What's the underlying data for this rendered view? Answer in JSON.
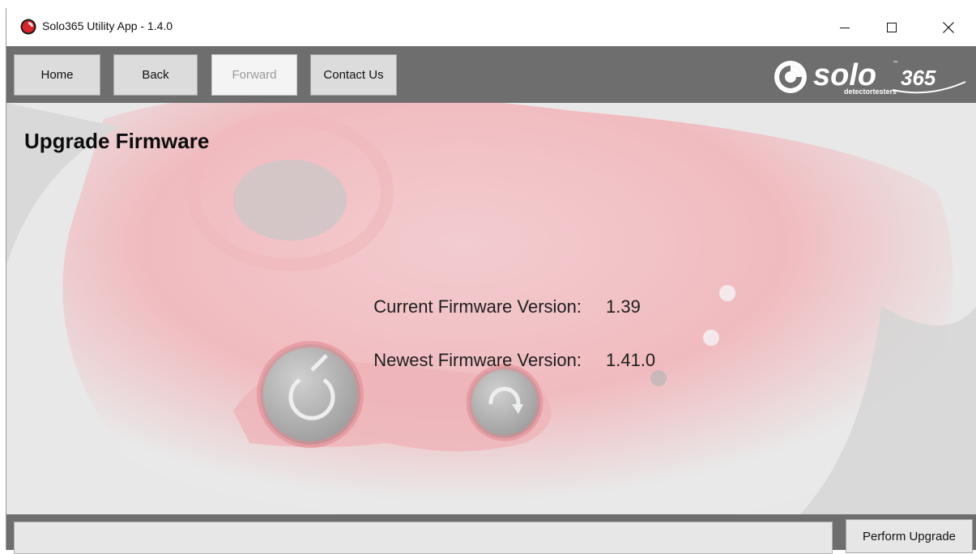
{
  "window": {
    "title": "Solo365 Utility App - 1.4.0",
    "app_icon": "solo365-app-icon",
    "controls": [
      "minimize-icon",
      "maximize-icon",
      "close-icon"
    ]
  },
  "nav": {
    "home": "Home",
    "back": "Back",
    "forward": "Forward",
    "contact": "Contact Us",
    "forward_enabled": false
  },
  "logo": {
    "text": "solo",
    "number": "365",
    "tm": "™",
    "tagline": "detectortesters"
  },
  "page": {
    "title": "Upgrade Firmware",
    "current_label": "Current Firmware Version:",
    "current_value": "1.39",
    "newest_label": "Newest Firmware Version:",
    "newest_value": "1.41.0"
  },
  "footer": {
    "status_text": "",
    "perform_upgrade": "Perform Upgrade"
  },
  "colors": {
    "navbar": "#6e6e6e",
    "button": "#dcdcdc",
    "accent_red": "#d8242a",
    "content_bg": "#e9e9e9"
  }
}
